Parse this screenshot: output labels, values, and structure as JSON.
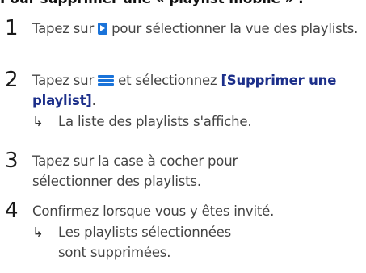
{
  "heading": "Pour supprimer une « playlist mobile » :",
  "steps": [
    {
      "number": "1",
      "before_icon": "Tapez sur ",
      "icon": "playlist-view-icon",
      "after_icon": " pour sélectionner la vue des playlists."
    },
    {
      "number": "2",
      "before_icon": "Tapez sur ",
      "icon": "menu-icon",
      "after_icon": " et sélectionnez ",
      "option": "[Supprimer une playlist]",
      "period": ".",
      "result_arrow": "↳",
      "result": "La liste des playlists s'affiche."
    },
    {
      "number": "3",
      "text": "Tapez sur la case à cocher pour sélectionner des playlists."
    },
    {
      "number": "4",
      "text": "Confirmez lorsque vous y êtes invité.",
      "result_arrow": "↳",
      "result": "Les playlists sélectionnées sont supprimées."
    }
  ],
  "colors": {
    "accent": "#1a73d9",
    "option_text": "#1c2f8a"
  }
}
